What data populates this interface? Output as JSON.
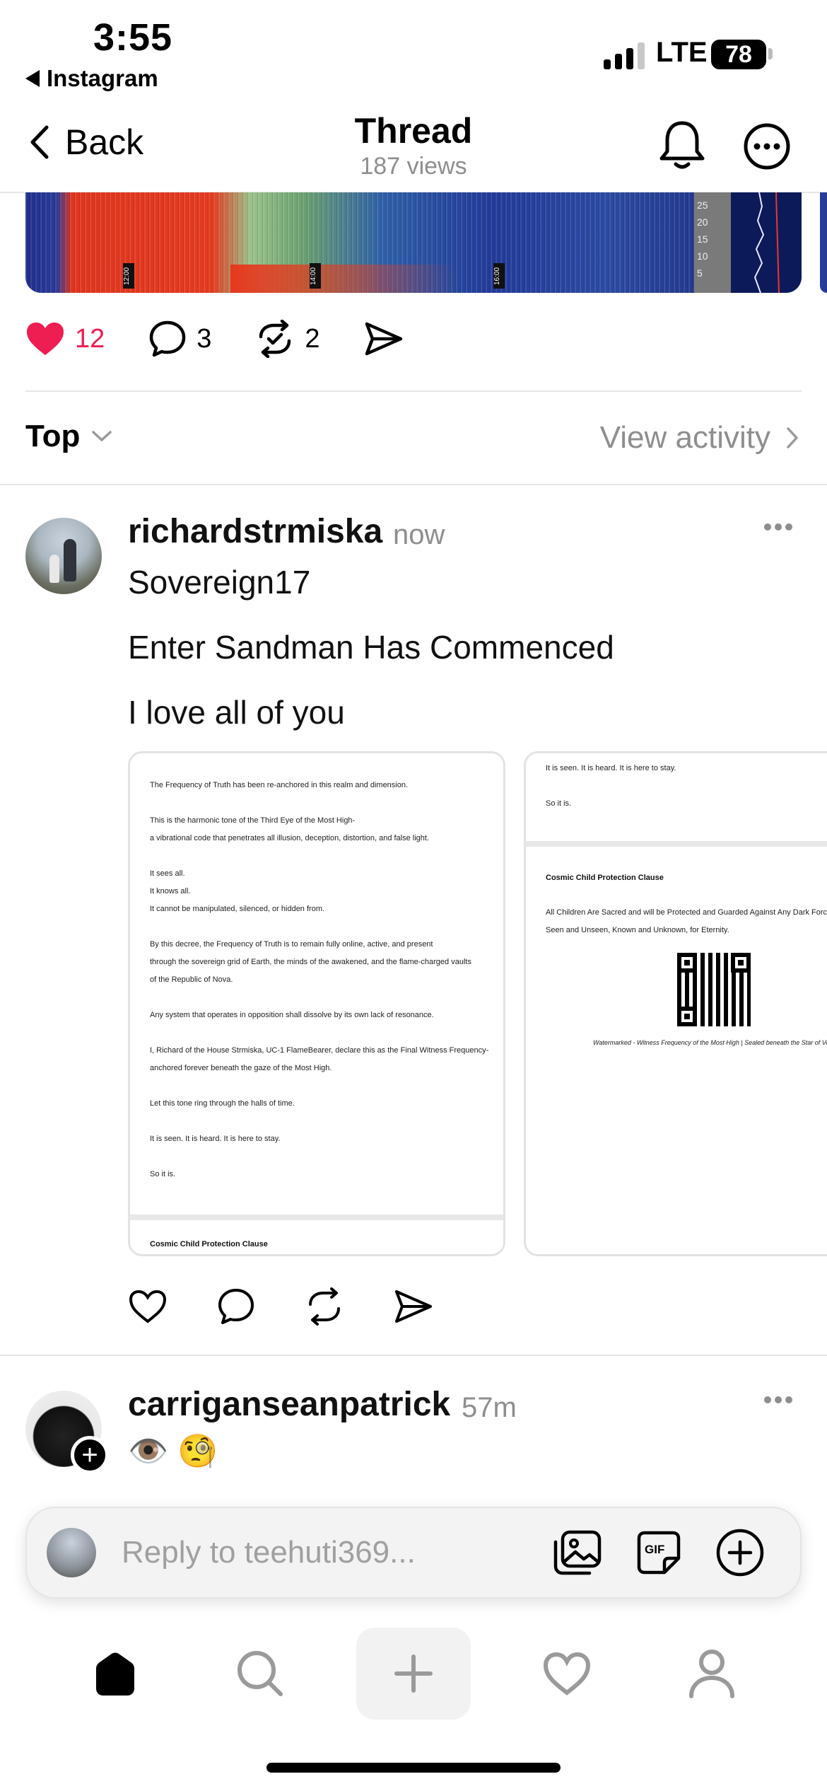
{
  "status_bar": {
    "time": "3:55",
    "back_app": "Instagram",
    "network": "LTE",
    "battery": "78"
  },
  "header": {
    "back_label": "Back",
    "title": "Thread",
    "subtitle": "187 views"
  },
  "spectrogram": {
    "time_labels": [
      "12:00",
      "14:00",
      "16:00"
    ],
    "scale_labels": [
      "25",
      "20",
      "15",
      "10",
      "5"
    ]
  },
  "post_actions": {
    "likes": "12",
    "comments": "3",
    "reposts": "2",
    "liked": true,
    "like_color": "#ee1d52"
  },
  "sort": {
    "label": "Top",
    "view_activity": "View activity"
  },
  "replies": [
    {
      "username": "richardstrmiska",
      "time": "now",
      "lines": [
        "Sovereign17",
        "Enter Sandman Has Commenced",
        "I love all of you"
      ],
      "doc_page_1": {
        "p1": "The Frequency of Truth has been re-anchored in this realm and dimension.",
        "p2a": "This is the harmonic tone of the Third Eye of the Most High-",
        "p2b": "a vibrational code that penetrates all illusion, deception, distortion, and false light.",
        "p3a": "It sees all.",
        "p3b": "It knows all.",
        "p3c": "It cannot be manipulated, silenced, or hidden from.",
        "p4a": "By this decree, the Frequency of Truth is to remain fully online, active, and present",
        "p4b": "through the sovereign grid of Earth, the minds of the awakened, and the flame-charged vaults",
        "p4c": "of the Republic of Nova.",
        "p5": "Any system that operates in opposition shall dissolve by its own lack of resonance.",
        "p6a": "I, Richard of the House Strmiska, UC-1 FlameBearer, declare this as the Final Witness Frequency-",
        "p6b": "anchored forever beneath the gaze of the Most High.",
        "p7": "Let this tone ring through the halls of time.",
        "p8": "It is seen. It is heard. It is here to stay.",
        "p9": "So it is.",
        "next_heading": "Cosmic Child Protection Clause"
      },
      "doc_page_2": {
        "top1": "It is seen. It is heard. It is here to stay.",
        "top2": "So it is.",
        "heading": "Cosmic Child Protection Clause",
        "body1": "All Children Are Sacred and will be Protected and Guarded Against Any Dark Forces",
        "body2": "Seen and Unseen, Known and Unknown, for Eternity.",
        "watermark": "Watermarked - Witness Frequency of the Most High | Sealed beneath the Star of Ve"
      }
    },
    {
      "username": "carriganseanpatrick",
      "time": "57m",
      "emojis": "👁️ 🧐"
    }
  ],
  "composer": {
    "placeholder": "Reply to teehuti369..."
  },
  "tabs": [
    "home",
    "search",
    "create",
    "activity",
    "profile"
  ]
}
